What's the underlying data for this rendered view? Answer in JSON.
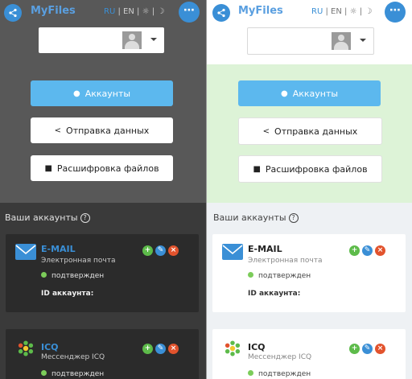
{
  "app": {
    "name": "MyFiles"
  },
  "langs": {
    "ru": "RU",
    "sep1": "|",
    "en": "EN",
    "sep2": "|",
    "sun": "☼",
    "sep3": "|",
    "moon": "☽"
  },
  "menu": {
    "icon": "⋯"
  },
  "buttons": {
    "accounts": "Аккаунты",
    "send": "Отправка данных",
    "decrypt": "Расшифровка файлов"
  },
  "section": {
    "title": "Ваши аккаунты",
    "help": "?"
  },
  "accounts": [
    {
      "name": "E-MAIL",
      "desc": "Электронная почта",
      "status": "подтвержден",
      "id_label": "ID аккаунта:"
    },
    {
      "name": "ICQ",
      "desc": "Мессенджер ICQ",
      "status": "подтвержден"
    }
  ],
  "colors": {
    "accent": "#3a8fd6",
    "primary_button": "#5cb8ee",
    "status_ok": "#7ccc5a",
    "light_hero": "#ddf3d7"
  },
  "icons": {
    "share": "share-icon",
    "user": "user-icon",
    "lock": "lock-icon",
    "mail": "mail-icon",
    "icq": "icq-flower-icon"
  }
}
